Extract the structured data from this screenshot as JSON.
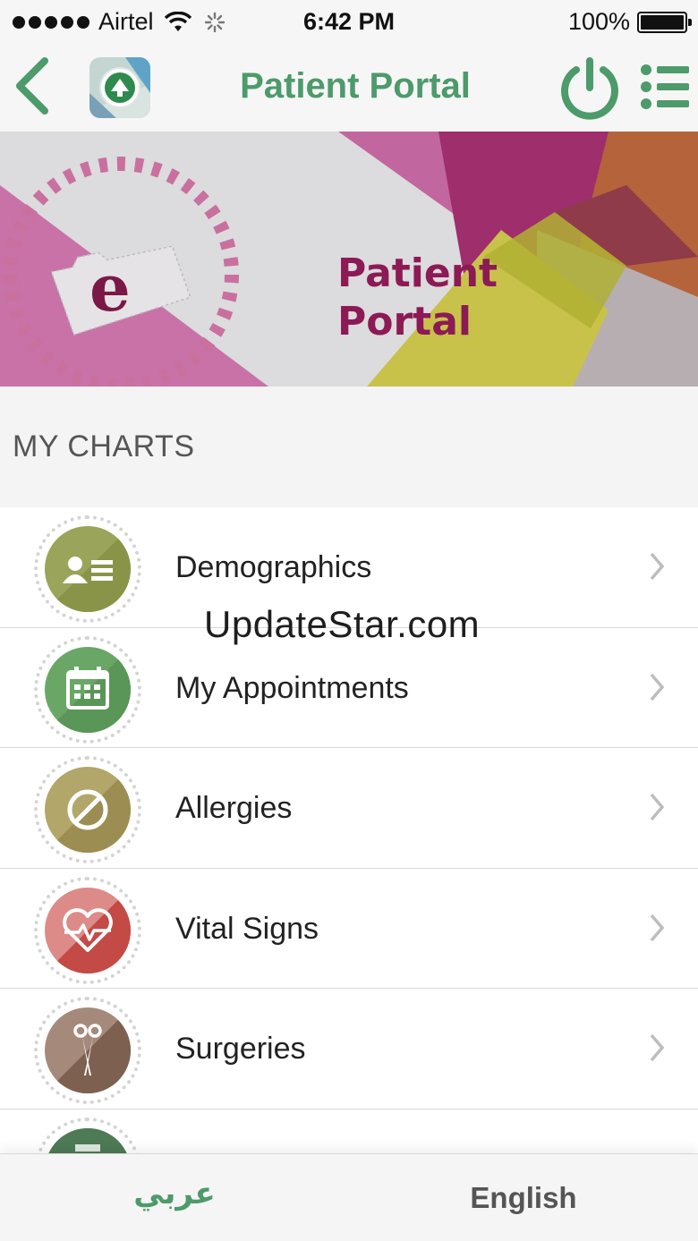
{
  "status_bar": {
    "carrier": "Airtel",
    "time": "6:42 PM",
    "battery": "100%"
  },
  "nav": {
    "title": "Patient Portal",
    "icons": [
      "back-chevron-icon",
      "ministry-logo",
      "power-icon",
      "menu-list-icon"
    ],
    "accent_color": "#4d9a6b"
  },
  "banner": {
    "title_line1": "Patient",
    "title_line2": "Portal",
    "emblem_letter": "e",
    "brand_color": "#8c1a55"
  },
  "section": {
    "header": "MY CHARTS"
  },
  "charts": [
    {
      "label": "Demographics",
      "icon": "demographics-id-card-icon",
      "color": "#9aa45a"
    },
    {
      "label": "My Appointments",
      "icon": "calendar-icon",
      "color": "#6aa767"
    },
    {
      "label": "Allergies",
      "icon": "prohibited-icon",
      "color": "#a79a5e"
    },
    {
      "label": "Vital Signs",
      "icon": "heart-pulse-icon",
      "color": "#c85a58"
    },
    {
      "label": "Surgeries",
      "icon": "scissors-icon",
      "color": "#8e7160"
    }
  ],
  "watermark": "UpdateStar.com",
  "bottom_bar": {
    "arabic_label": "عربي",
    "english_label": "English"
  }
}
